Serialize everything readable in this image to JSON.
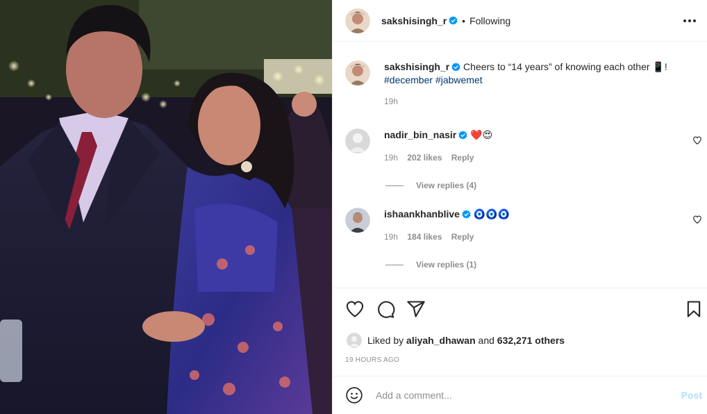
{
  "post": {
    "author": "sakshisingh_r",
    "following_label": "Following",
    "separator": "•",
    "more_icon": "more-horizontal-icon"
  },
  "caption": {
    "username": "sakshisingh_r",
    "text": "Cheers to “14 years” of knowing each other",
    "emoji": "📱",
    "tail": "!",
    "hashtags": [
      "#december",
      "#jabwemet"
    ],
    "time": "19h"
  },
  "comments": [
    {
      "username": "nadir_bin_nasir",
      "text": "❤️😍",
      "time": "19h",
      "likes": "202 likes",
      "reply": "Reply",
      "view_replies": "View replies (4)"
    },
    {
      "username": "ishaankhanblive",
      "text": "🧿🧿🧿",
      "time": "19h",
      "likes": "184 likes",
      "reply": "Reply",
      "view_replies": "View replies (1)"
    }
  ],
  "likes": {
    "prefix": "Liked by",
    "user": "aliyah_dhawan",
    "middle": "and",
    "others": "632,271 others"
  },
  "timestamp": "19 HOURS AGO",
  "comment_box": {
    "placeholder": "Add a comment...",
    "post_label": "Post"
  },
  "colors": {
    "verified": "#0095f6",
    "hashtag": "#00376b",
    "muted": "#8e8e8e",
    "post_disabled": "#b2dffc"
  }
}
